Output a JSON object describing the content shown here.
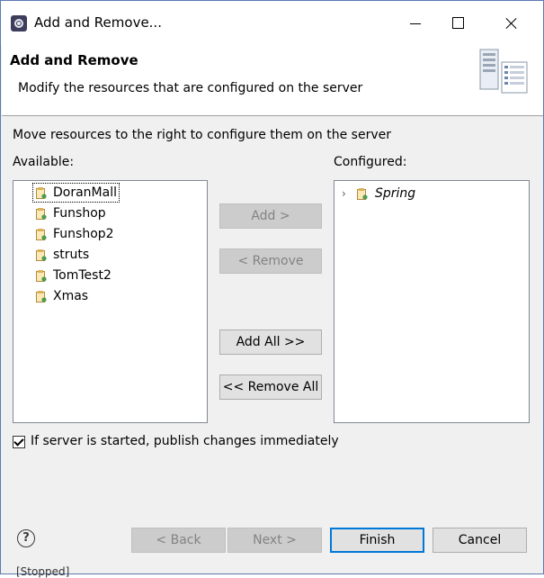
{
  "window": {
    "title": "Add and Remove...",
    "icon": "eclipse-icon",
    "controls": [
      "minimize",
      "maximize",
      "close"
    ]
  },
  "header": {
    "title": "Add and Remove",
    "description": "Modify the resources that are configured on the server",
    "graphic": "server-icon"
  },
  "main": {
    "instruction": "Move resources to the right to configure them on the server",
    "available_label": "Available:",
    "configured_label": "Configured:",
    "available": [
      {
        "label": "DoranMall",
        "icon": "web-module-icon",
        "focused": true
      },
      {
        "label": "Funshop",
        "icon": "web-module-icon"
      },
      {
        "label": "Funshop2",
        "icon": "web-module-icon"
      },
      {
        "label": "struts",
        "icon": "web-module-icon"
      },
      {
        "label": "TomTest2",
        "icon": "web-module-icon"
      },
      {
        "label": "Xmas",
        "icon": "web-module-icon"
      }
    ],
    "configured": [
      {
        "label": "Spring",
        "icon": "web-module-icon",
        "expandable": true
      }
    ],
    "buttons": {
      "add": "Add >",
      "remove": "< Remove",
      "add_all": "Add All >>",
      "remove_all": "<< Remove All"
    },
    "publish_checkbox": {
      "label": "If server is started, publish changes immediately",
      "checked": true
    }
  },
  "footer": {
    "help": "?",
    "back": "< Back",
    "next": "Next >",
    "finish": "Finish",
    "cancel": "Cancel"
  },
  "background": {
    "status_text": "[Stopped]"
  }
}
